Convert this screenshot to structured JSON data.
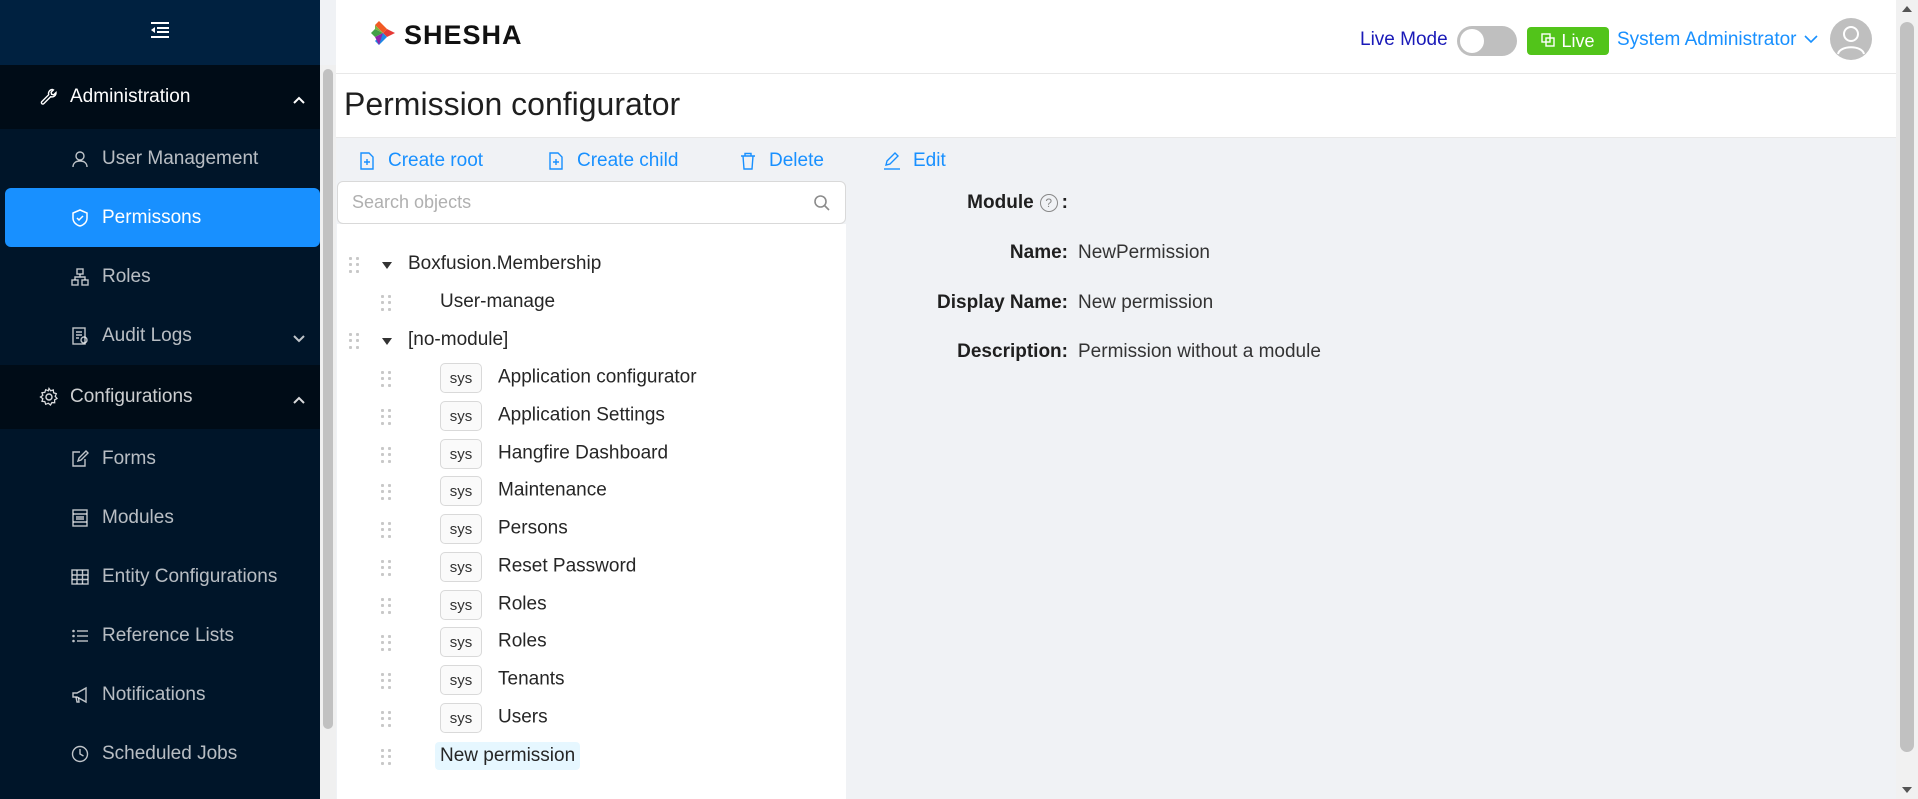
{
  "sidebar": {
    "groups": [
      {
        "label": "Administration",
        "icon": "wrench-icon",
        "items": [
          {
            "label": "User Management",
            "icon": "user-icon"
          },
          {
            "label": "Permissons",
            "icon": "shield-icon"
          },
          {
            "label": "Roles",
            "icon": "roles-icon"
          },
          {
            "label": "Audit Logs",
            "icon": "audit-icon"
          }
        ]
      },
      {
        "label": "Configurations",
        "icon": "gear-icon",
        "items": [
          {
            "label": "Forms",
            "icon": "form-icon"
          },
          {
            "label": "Modules",
            "icon": "modules-icon"
          },
          {
            "label": "Entity Configurations",
            "icon": "table-icon"
          },
          {
            "label": "Reference Lists",
            "icon": "list-icon"
          },
          {
            "label": "Notifications",
            "icon": "megaphone-icon"
          },
          {
            "label": "Scheduled Jobs",
            "icon": "clock-icon"
          }
        ]
      }
    ],
    "active_item": "Permissons"
  },
  "header": {
    "logo_text": "SHESHA",
    "live_mode_label": "Live Mode",
    "live_mode_on": false,
    "live_badge": "Live",
    "user_name": "System Administrator"
  },
  "page": {
    "title": "Permission configurator"
  },
  "toolbar": {
    "create_root": "Create root",
    "create_child": "Create child",
    "delete": "Delete",
    "edit": "Edit"
  },
  "search": {
    "placeholder": "Search objects"
  },
  "tree": {
    "module1": {
      "name": "Boxfusion.Membership",
      "children": [
        "User-manage"
      ]
    },
    "module2": {
      "name": "[no-module]",
      "tag": "sys",
      "children": [
        "Application configurator",
        "Application Settings",
        "Hangfire Dashboard",
        "Maintenance",
        "Persons",
        "Reset Password",
        "Roles",
        "Roles",
        "Tenants",
        "Users"
      ],
      "selected": "New permission"
    }
  },
  "details": {
    "module_label": "Module",
    "module_value": "",
    "name_label": "Name",
    "name_value": "NewPermission",
    "display_name_label": "Display Name",
    "display_name_value": "New permission",
    "description_label": "Description",
    "description_value": "Permission without a module"
  },
  "colors": {
    "sidebar_bg": "#001529",
    "active_bg": "#1890ff",
    "link": "#1890ff",
    "live_badge": "#52c41a"
  }
}
